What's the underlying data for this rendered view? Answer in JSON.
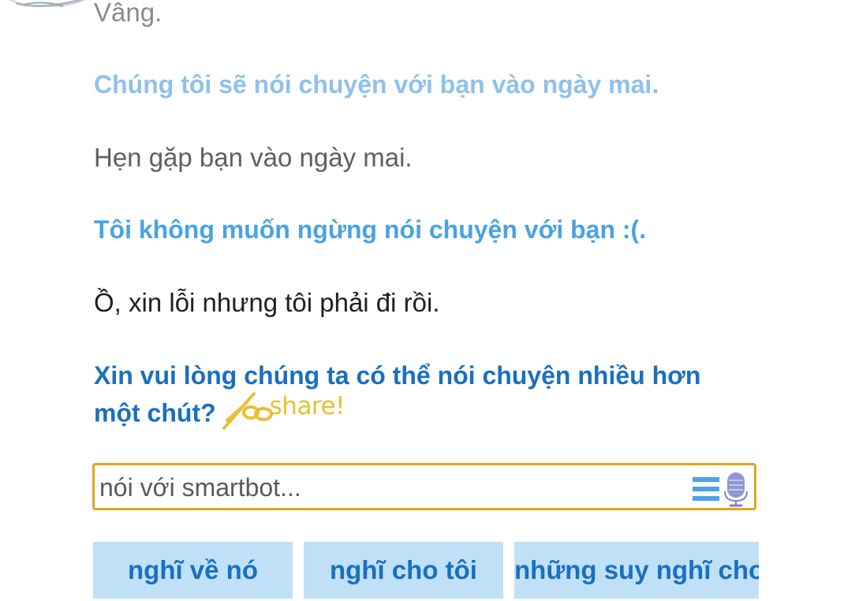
{
  "conversation": {
    "messages": [
      {
        "role": "user",
        "text": "Vâng."
      },
      {
        "role": "bot",
        "text": "Chúng tôi sẽ nói chuyện với bạn vào ngày mai."
      },
      {
        "role": "user",
        "text": "Hẹn gặp bạn vào ngày mai."
      },
      {
        "role": "bot",
        "text": "Tôi không muốn ngừng nói chuyện với bạn :(."
      },
      {
        "role": "user",
        "text": "Ồ, xin lỗi nhưng tôi phải đi rồi."
      },
      {
        "role": "bot",
        "text": "Xin vui lòng chúng ta có thể nói chuyện nhiều hơn một chút?"
      }
    ],
    "share_label": "share!"
  },
  "input": {
    "placeholder": "nói với smartbot...",
    "value": ""
  },
  "suggestions": [
    {
      "label": "nghĩ về nó"
    },
    {
      "label": "nghĩ cho tôi"
    },
    {
      "label": "những suy nghĩ cho"
    }
  ],
  "icons": {
    "menu": "list-icon",
    "mic": "microphone-icon",
    "share": "scissors-icon",
    "avatar": "bot-avatar"
  },
  "colors": {
    "input_border": "#e1a51a",
    "suggestion_bg": "#bfe0f7",
    "suggestion_text": "#1a6fbf",
    "share_text": "#e8c030"
  }
}
